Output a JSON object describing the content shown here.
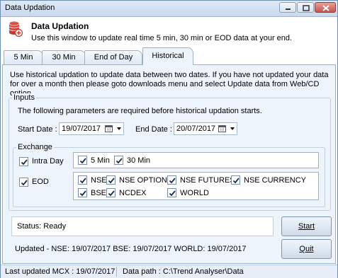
{
  "window": {
    "title": "Data Updation"
  },
  "header": {
    "title": "Data Updation",
    "subtitle": "Use this window to update real time 5 min, 30 min or EOD data at your end."
  },
  "tabs": [
    {
      "label": "5 Min",
      "active": false
    },
    {
      "label": "30 Min",
      "active": false
    },
    {
      "label": "End of Day",
      "active": false
    },
    {
      "label": "Historical",
      "active": true
    }
  ],
  "historical": {
    "info": "Use historical updation to update data between two dates. If you have not updated your data for over a month then please goto downloads menu and select Update data from Web/CD option.",
    "inputs": {
      "legend": "Inputs",
      "note": "The following parameters are required before historical updation starts.",
      "start_label": "Start Date :",
      "start_value": "19/07/2017",
      "end_label": "End Date :",
      "end_value": "20/07/2017"
    },
    "exchange": {
      "legend": "Exchange",
      "intraday_label": "Intra Day",
      "intraday_checked": true,
      "intraday_options": [
        {
          "label": "5 Min",
          "checked": true
        },
        {
          "label": "30 Min",
          "checked": true
        }
      ],
      "eod_label": "EOD",
      "eod_checked": true,
      "eod_options": [
        {
          "label": "NSE",
          "checked": true
        },
        {
          "label": "NSE OPTIONS",
          "checked": true
        },
        {
          "label": "NSE FUTURES",
          "checked": true
        },
        {
          "label": "NSE CURRENCY",
          "checked": true
        },
        {
          "label": "BSE",
          "checked": true
        },
        {
          "label": "NCDEX",
          "checked": true
        },
        {
          "label": "WORLD",
          "checked": true
        }
      ]
    },
    "status": "Status: Ready",
    "updated": "Updated - NSE: 19/07/2017  BSE: 19/07/2017  WORLD: 19/07/2017",
    "start_button": "Start",
    "quit_button": "Quit"
  },
  "statusbar": {
    "last_updated": "Last updated MCX : 19/07/2017",
    "data_path": "Data path : C:\\Trend Analyser\\Data"
  },
  "icons": {
    "header": "database-refresh-icon",
    "calendar": "calendar-icon",
    "check": "check-icon"
  }
}
